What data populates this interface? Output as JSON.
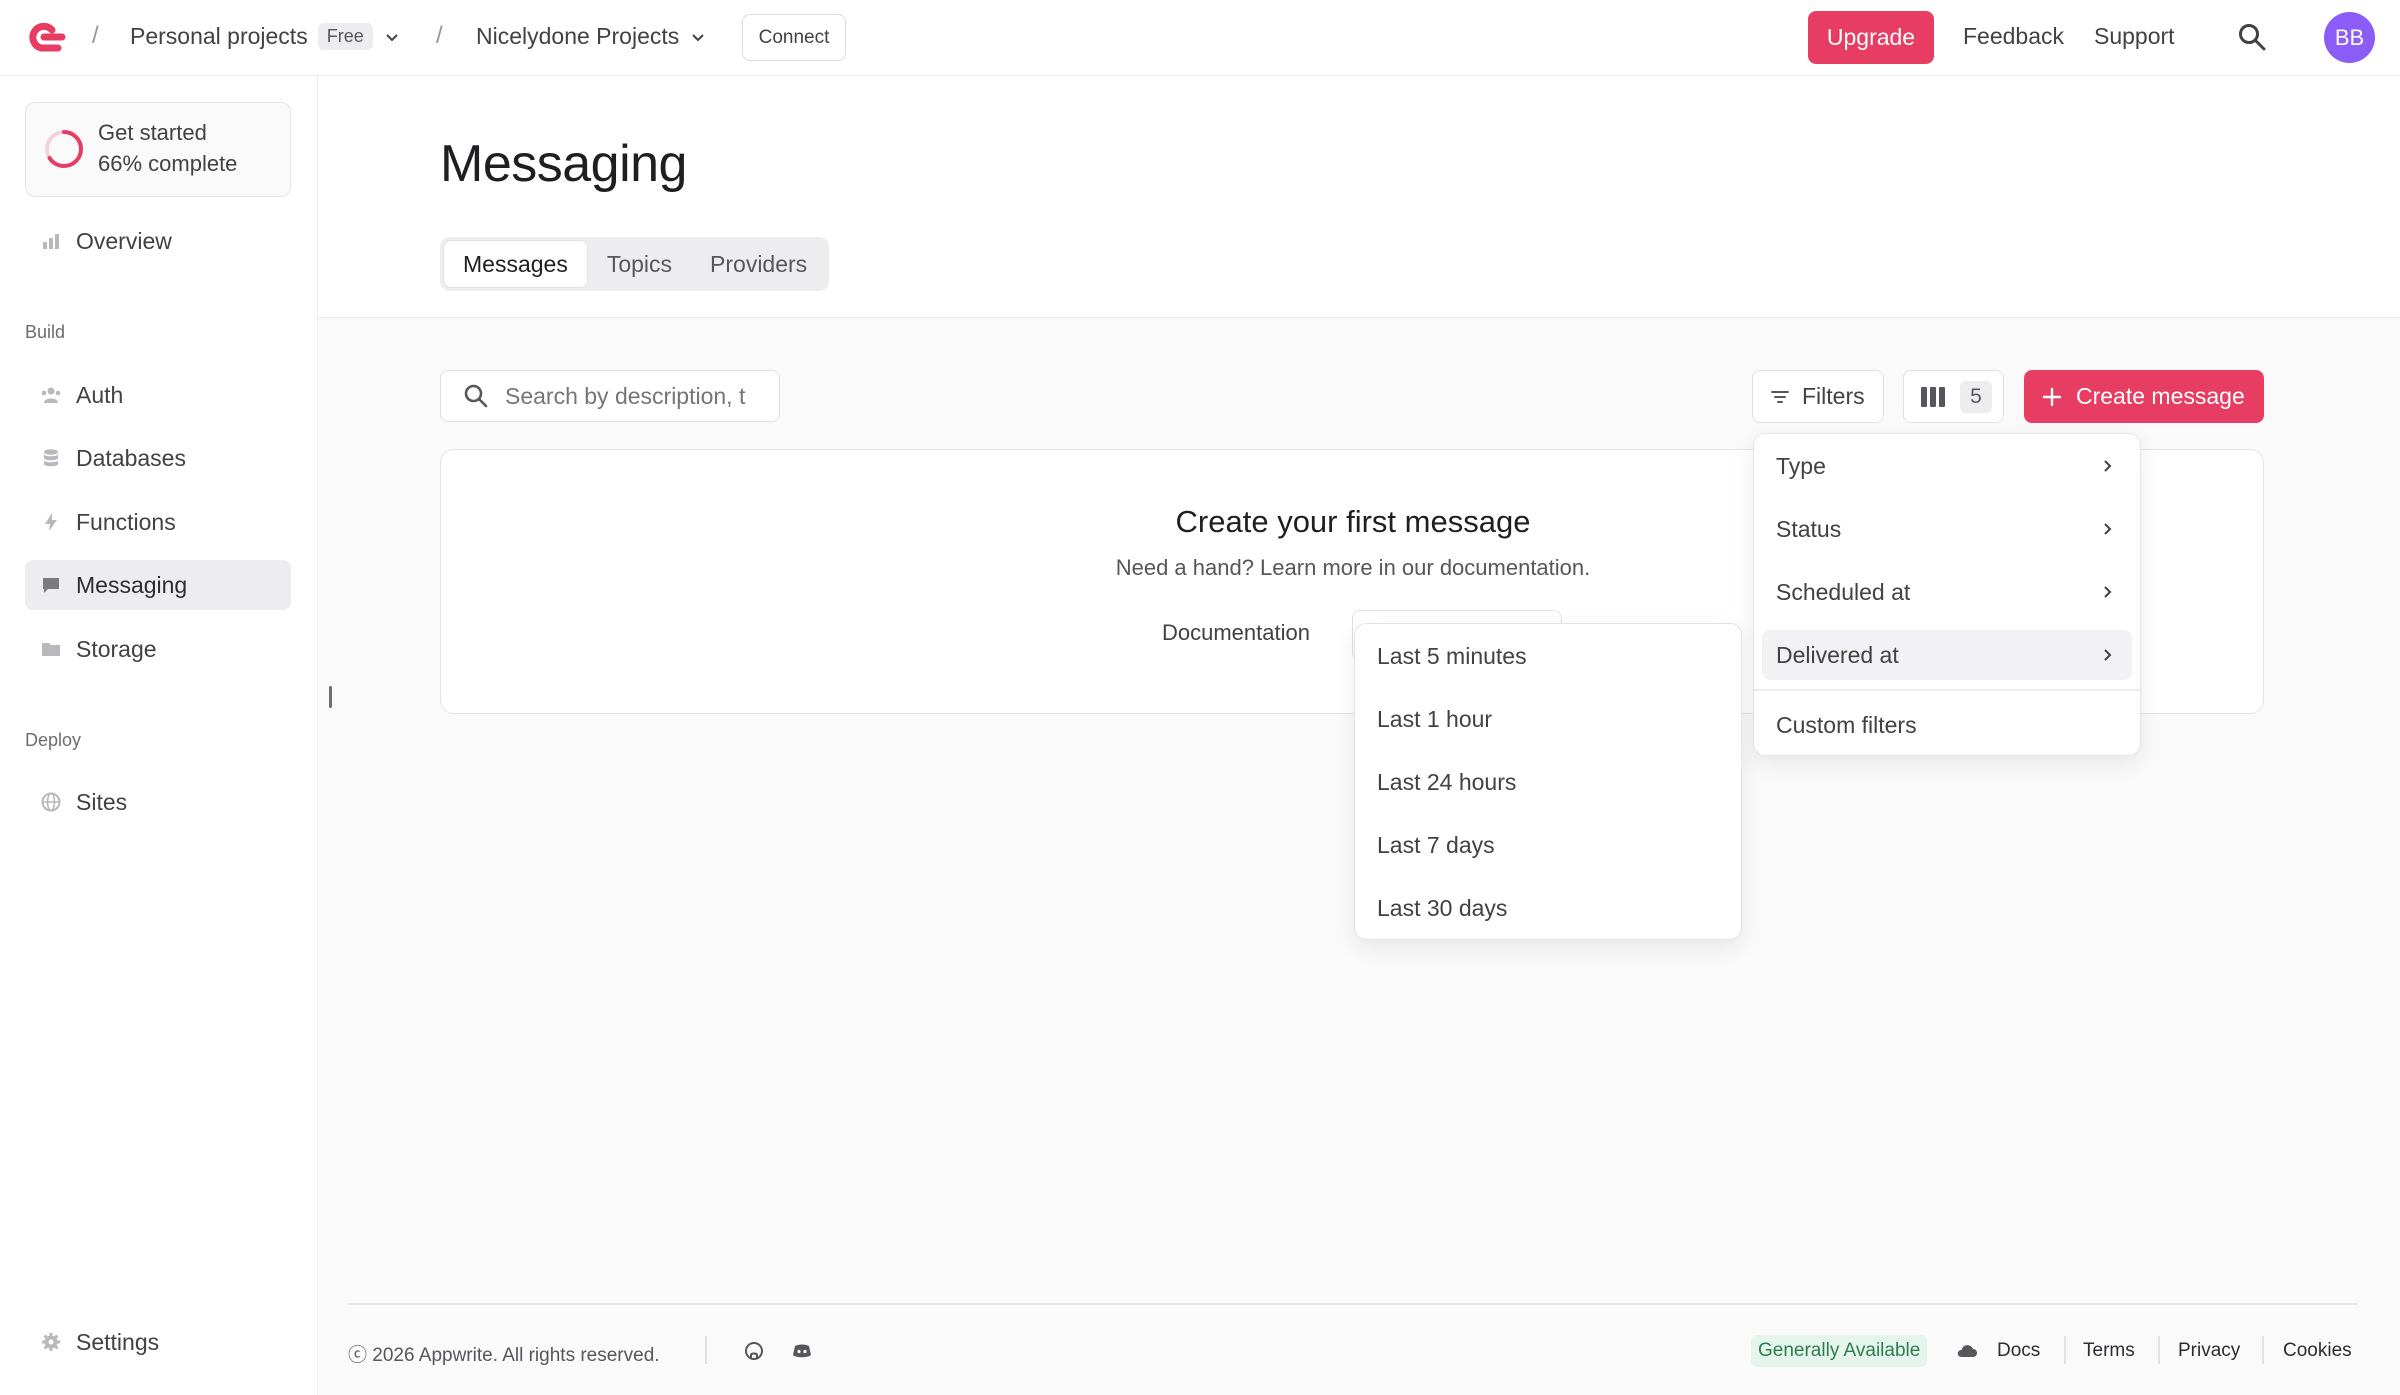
{
  "topbar": {
    "org_name": "Personal projects",
    "org_plan": "Free",
    "project_name": "Nicelydone Projects",
    "connect_label": "Connect",
    "upgrade_label": "Upgrade",
    "feedback_label": "Feedback",
    "support_label": "Support",
    "avatar_initials": "BB"
  },
  "sidebar": {
    "get_started": {
      "title": "Get started",
      "progress_text": "66% complete",
      "progress": 0.66
    },
    "overview": "Overview",
    "build_section": "Build",
    "build_items": [
      "Auth",
      "Databases",
      "Functions",
      "Messaging",
      "Storage"
    ],
    "deploy_section": "Deploy",
    "deploy_items": [
      "Sites"
    ],
    "settings": "Settings"
  },
  "page": {
    "title": "Messaging",
    "tabs": [
      {
        "label": "Messages",
        "active": true
      },
      {
        "label": "Topics",
        "active": false
      },
      {
        "label": "Providers",
        "active": false
      }
    ]
  },
  "toolbar": {
    "search_placeholder": "Search by description, t",
    "filters_label": "Filters",
    "columns_count": "5",
    "create_label": "Create message"
  },
  "empty_state": {
    "title": "Create your first message",
    "subtitle": "Need a hand? Learn more in our documentation.",
    "doc_link": "Documentation"
  },
  "filters_menu": {
    "items": [
      "Type",
      "Status",
      "Scheduled at",
      "Delivered at"
    ],
    "highlighted": "Delivered at",
    "custom": "Custom filters"
  },
  "time_menu": {
    "items": [
      "Last 5 minutes",
      "Last 1 hour",
      "Last 24 hours",
      "Last 7 days",
      "Last 30 days"
    ]
  },
  "footer": {
    "copyright": "ⓒ 2026 Appwrite. All rights reserved.",
    "status": "Generally Available",
    "links": [
      "Docs",
      "Terms",
      "Privacy",
      "Cookies"
    ]
  },
  "colors": {
    "brand": "#e83d63",
    "avatar": "#8b5cf6",
    "status_green": "#2e7d4f"
  }
}
